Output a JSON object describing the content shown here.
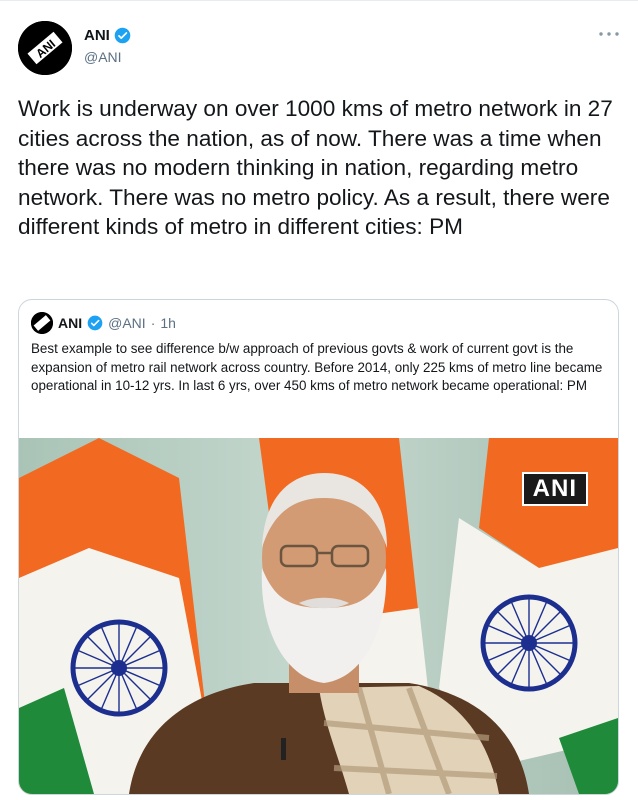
{
  "tweet": {
    "author_name": "ANI",
    "author_handle": "@ANI",
    "more_icon": "ellipsis-icon",
    "text": "Work is underway on over 1000 kms of metro network in 27 cities across the nation, as of now. There was a time when there was no modern thinking in nation, regarding metro network. There was no metro policy. As a result, there were different kinds of metro in different cities: PM"
  },
  "quoted": {
    "author_name": "ANI",
    "author_handle": "@ANI",
    "separator": "·",
    "time": "1h",
    "text": "Best example to see difference b/w approach of previous govts & work of current govt is the expansion of metro rail network across country. Before 2014, only 225 kms of metro line became operational in 10-12 yrs. In last 6 yrs, over 450 kms of metro network became operational: PM",
    "media": {
      "watermark": "ANI"
    }
  },
  "colors": {
    "verified_blue": "#1da1f2",
    "secondary_text": "#5b7083",
    "border": "#ccd6dd",
    "saffron": "#f26a21",
    "flag_green": "#1f8a3a",
    "chakra_navy": "#1c2f8f"
  }
}
